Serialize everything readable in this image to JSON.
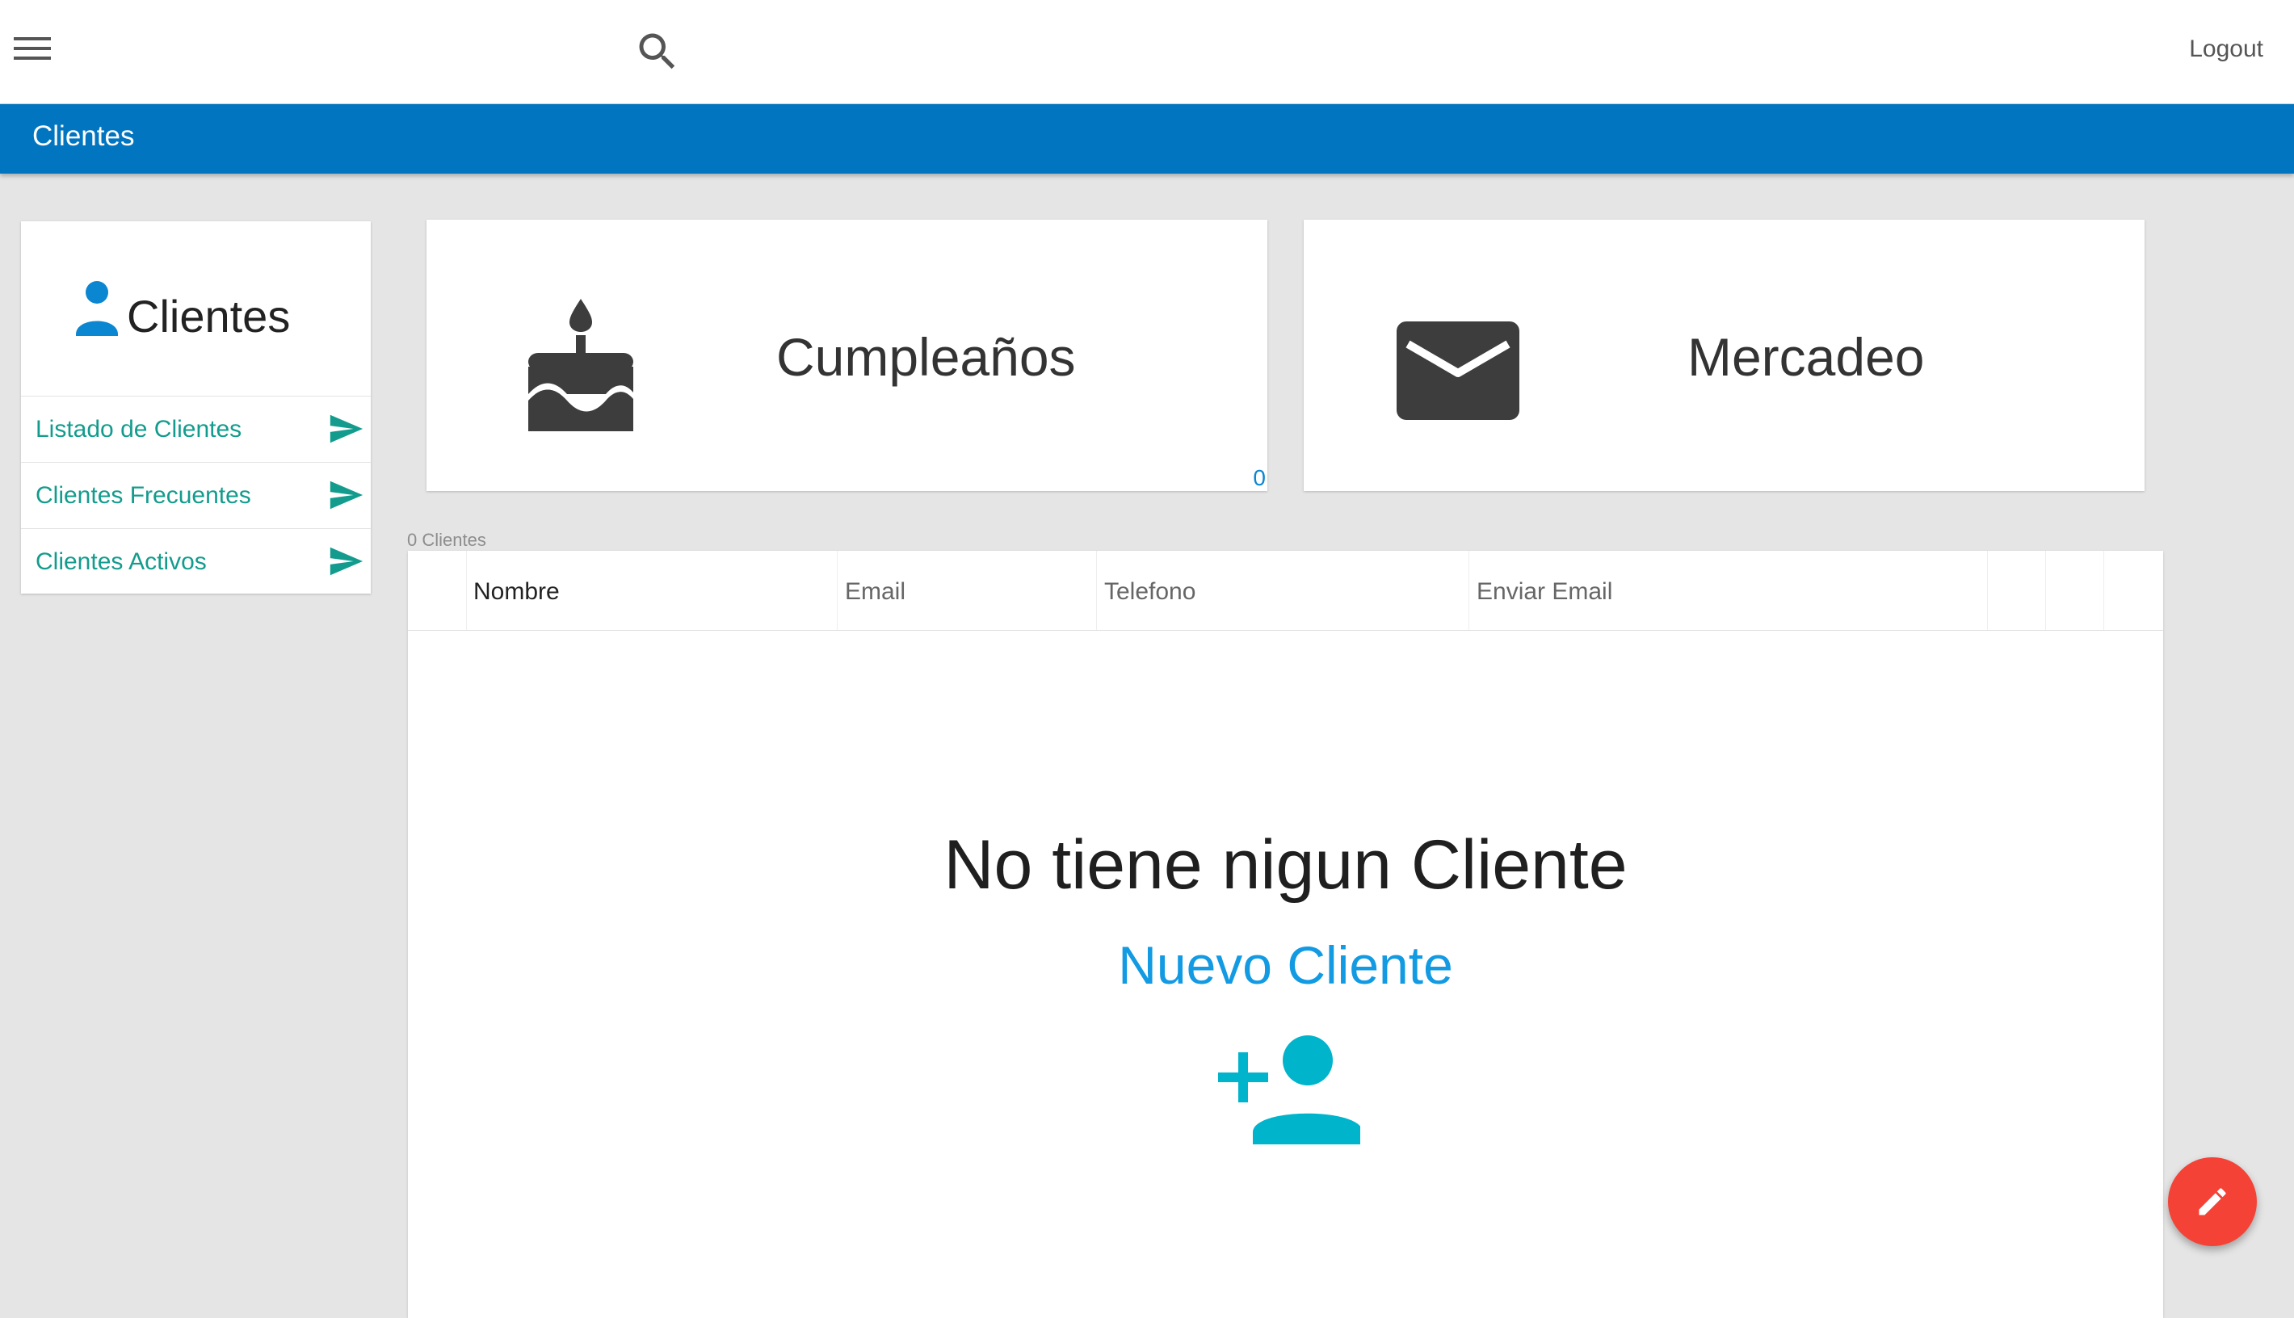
{
  "topbar": {
    "menu_icon": "menu-icon",
    "search_icon": "search-icon",
    "logout_label": "Logout"
  },
  "page": {
    "title": "Clientes"
  },
  "sidebar": {
    "title": "Clientes",
    "title_icon": "person-icon",
    "items": [
      {
        "label": "Listado de Clientes",
        "icon": "send-icon"
      },
      {
        "label": "Clientes Frecuentes",
        "icon": "send-icon"
      },
      {
        "label": "Clientes Activos",
        "icon": "send-icon"
      }
    ]
  },
  "features": [
    {
      "title": "Cumpleaños",
      "icon": "cake-icon",
      "count": "0"
    },
    {
      "title": "Mercadeo",
      "icon": "mail-icon"
    }
  ],
  "table": {
    "count_label": "0 Clientes",
    "columns": [
      "Nombre",
      "Email",
      "Telefono",
      "Enviar Email"
    ],
    "rows": []
  },
  "empty_state": {
    "message": "No tiene nigun Cliente",
    "action_label": "Nuevo Cliente",
    "action_icon": "add-person-icon"
  },
  "fab": {
    "icon": "edit-icon"
  },
  "colors": {
    "primary_bar": "#0275c1",
    "sidebar_link": "#139c8d",
    "link_blue": "#129ae3",
    "icon_teal": "#00b4cc",
    "fab": "#f44336"
  }
}
